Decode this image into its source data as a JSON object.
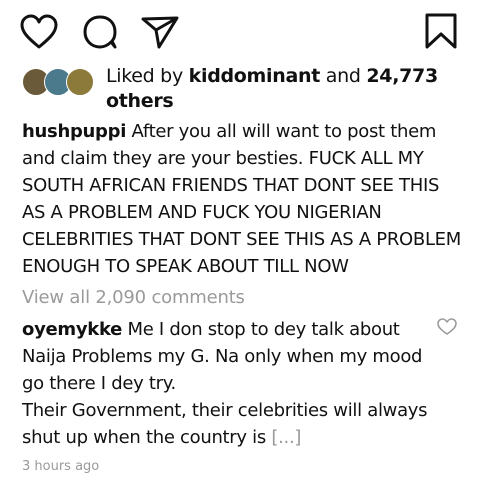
{
  "actions": {
    "like_icon": "heart-icon",
    "comment_icon": "comment-bubble-icon",
    "share_icon": "paper-plane-icon",
    "save_icon": "bookmark-icon"
  },
  "likes": {
    "prefix": "Liked by",
    "user": "kiddominant",
    "and": "and",
    "others": "24,773 others",
    "avatar_colors": [
      "#6b5a3a",
      "#4a7a8c",
      "#8c7a3a"
    ]
  },
  "caption": {
    "username": "hushpuppi",
    "text": "After you all will want to post them and claim they are your besties. FUCK ALL MY SOUTH AFRICAN FRIENDS THAT DONT SEE THIS AS A PROBLEM AND FUCK YOU NIGERIAN CELEBRITIES THAT DONT SEE THIS AS A PROBLEM ENOUGH TO SPEAK ABOUT TILL NOW"
  },
  "view_comments": "View all 2,090 comments",
  "comment": {
    "username": "oyemykke",
    "text_line1": "Me I don stop to dey talk about Naija Problems my G. Na only when my mood go there I dey try.",
    "text_line2": "Their Government, their celebrities will always shut up when the country is",
    "more": "[...]"
  },
  "timestamp": "3 hours ago"
}
